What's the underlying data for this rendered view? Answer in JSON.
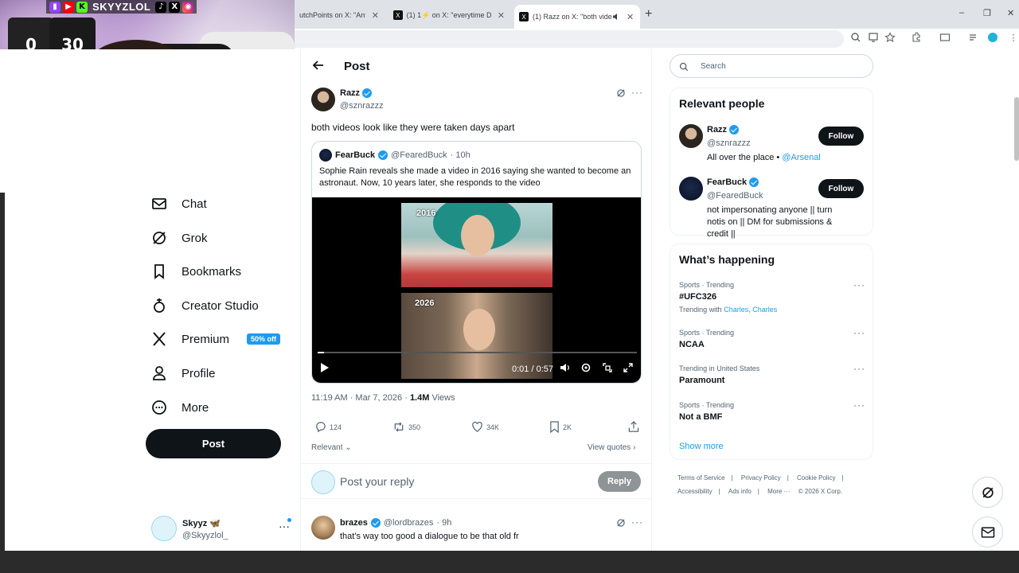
{
  "stream": {
    "handle": "SKYYZLOL",
    "jersey_numbers": [
      "0",
      "30"
    ]
  },
  "browser": {
    "tabs": [
      {
        "title": "utchPoints on X: \"Anthony",
        "active": false
      },
      {
        "title": "(1) 1⚡ on X: \"everytime Dillon",
        "active": false
      },
      {
        "title": "(1) Razz on X: \"both videos",
        "active": true
      }
    ],
    "new_tab": "+",
    "window_controls": [
      "–",
      "❐",
      "✕"
    ]
  },
  "nav": {
    "items": [
      {
        "label": "Chat",
        "icon": "mail-icon"
      },
      {
        "label": "Grok",
        "icon": "grok-icon"
      },
      {
        "label": "Bookmarks",
        "icon": "bookmark-icon"
      },
      {
        "label": "Creator Studio",
        "icon": "creator-studio-icon"
      },
      {
        "label": "Premium",
        "icon": "x-logo-icon",
        "badge": "50% off"
      },
      {
        "label": "Profile",
        "icon": "person-icon"
      },
      {
        "label": "More",
        "icon": "more-circle-icon"
      }
    ],
    "post_button": "Post",
    "account": {
      "name": "Skyyz 🦋",
      "handle": "@Skyyzlol_"
    }
  },
  "main": {
    "title": "Post",
    "post": {
      "author_name": "Razz",
      "author_handle": "@sznrazzz",
      "text": "both videos look like they were taken days apart",
      "quote": {
        "author_name": "FearBuck",
        "author_handle": "@FearedBuck",
        "time": "· 10h",
        "text": "Sophie Rain reveals she made a video in 2016 saying she wanted to become an astronaut. Now, 10 years later, she responds to the video",
        "video": {
          "label_top": "2016",
          "label_bottom": "2026",
          "time": "0:01 / 0:57",
          "progress": 0.02
        }
      },
      "timestamp": "11:19 AM · Mar 7, 2026",
      "views_count": "1.4M",
      "views_label": "Views",
      "stats": {
        "replies": "124",
        "reposts": "350",
        "likes": "34K",
        "bookmarks": "2K"
      }
    },
    "sort_label": "Relevant",
    "view_quotes": "View quotes",
    "reply_placeholder": "Post your reply",
    "reply_button": "Reply",
    "reply": {
      "author_name": "brazes",
      "author_handle": "@lordbrazes",
      "time": "· 9h",
      "text": "that's way too good a dialogue to be that old fr"
    }
  },
  "sidebar": {
    "search_placeholder": "Search",
    "relevant_title": "Relevant people",
    "people": [
      {
        "name": "Razz",
        "handle": "@sznrazzz",
        "bio": "All over the place • ",
        "bio_link": "@Arsenal",
        "follow": "Follow"
      },
      {
        "name": "FearBuck",
        "handle": "@FearedBuck",
        "bio": "not impersonating anyone || turn notis on || DM for submissions & credit ||",
        "bio_link": "",
        "follow": "Follow"
      }
    ],
    "happening_title": "What’s happening",
    "trends": [
      {
        "meta": "Sports · Trending",
        "title": "#UFC326",
        "with_prefix": "Trending with",
        "with": "Charles, Charles"
      },
      {
        "meta": "Sports · Trending",
        "title": "NCAA"
      },
      {
        "meta": "Trending in United States",
        "title": "Paramount"
      },
      {
        "meta": "Sports · Trending",
        "title": "Not a BMF"
      }
    ],
    "show_more": "Show more",
    "footer": [
      "Terms of Service",
      "Privacy Policy",
      "Cookie Policy",
      "Accessibility",
      "Ads info",
      "More ···",
      "© 2026 X Corp."
    ]
  }
}
